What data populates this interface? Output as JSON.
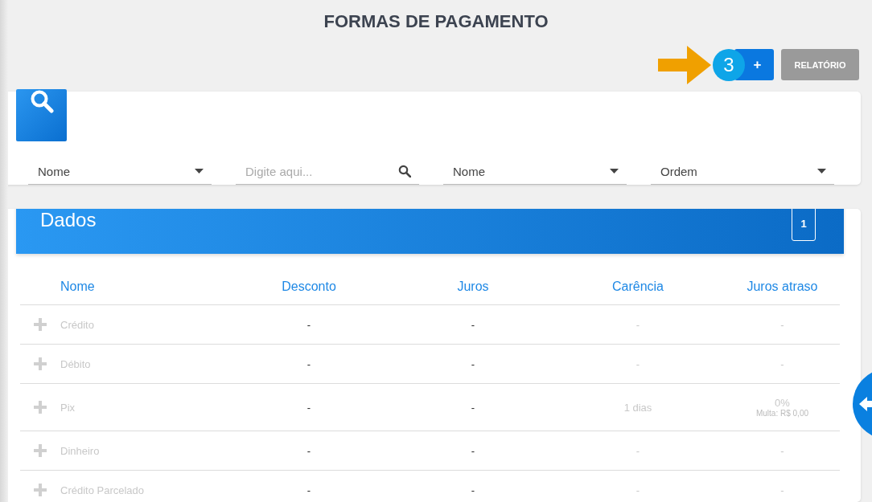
{
  "title": "FORMAS DE PAGAMENTO",
  "actions": {
    "callout": "3",
    "add_button": "+",
    "report_button": "RELATÓRIO"
  },
  "filters": [
    {
      "kind": "select",
      "value": "Nome"
    },
    {
      "kind": "search",
      "placeholder": "Digite aqui..."
    },
    {
      "kind": "select",
      "value": "Nome"
    },
    {
      "kind": "select",
      "value": "Ordem"
    }
  ],
  "data_panel": {
    "title": "Dados",
    "page": "1"
  },
  "table": {
    "columns": [
      "Nome",
      "Desconto",
      "Juros",
      "Carência",
      "Juros atraso"
    ],
    "rows": [
      {
        "cells": [
          [
            "Crédito"
          ],
          [
            "-"
          ],
          [
            "-"
          ],
          [
            "-"
          ],
          [
            "-"
          ]
        ]
      },
      {
        "cells": [
          [
            "Débito"
          ],
          [
            "-"
          ],
          [
            "-"
          ],
          [
            "-"
          ],
          [
            "-"
          ]
        ]
      },
      {
        "cells": [
          [
            "Pix"
          ],
          [
            "-"
          ],
          [
            "-"
          ],
          [
            "1 dias"
          ],
          [
            "0%",
            "Multa: R$ 0,00"
          ]
        ]
      },
      {
        "cells": [
          [
            "Dinheiro"
          ],
          [
            "-"
          ],
          [
            "-"
          ],
          [
            "-"
          ],
          [
            "-"
          ]
        ]
      },
      {
        "cells": [
          [
            "Crédito Parcelado"
          ],
          [
            "-"
          ],
          [
            "-"
          ],
          [
            "-"
          ],
          [
            "-"
          ]
        ]
      }
    ]
  }
}
